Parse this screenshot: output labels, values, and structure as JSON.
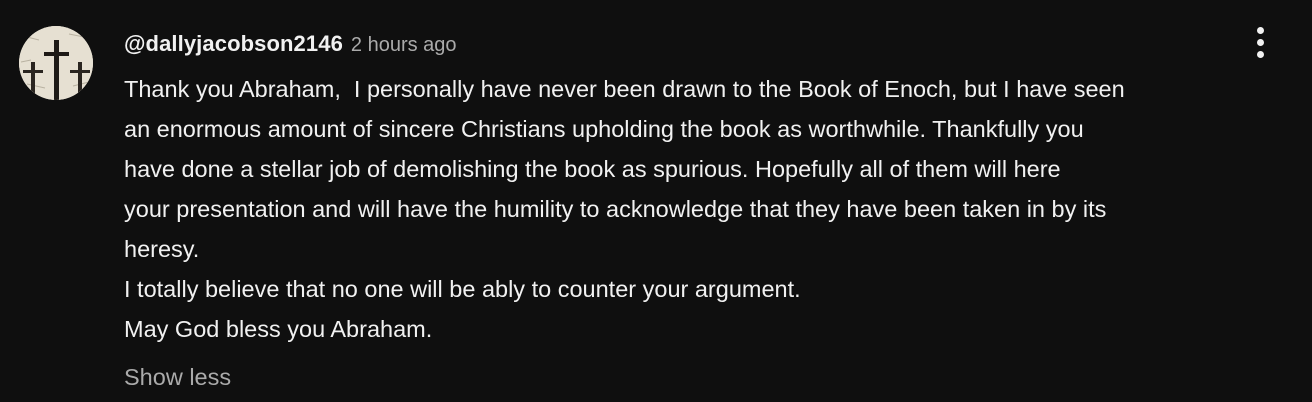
{
  "comment": {
    "avatar": {
      "icon": "crosses-avatar-icon"
    },
    "author": "@dallyjacobson2146",
    "timestamp": "2 hours ago",
    "body_lines": [
      "Thank you Abraham,  I personally have never been drawn to the Book of Enoch, but I have seen",
      "an enormous amount of sincere Christians upholding the book as worthwhile. Thankfully you",
      "have done a stellar job of demolishing the book as spurious. Hopefully all of them will here",
      "your presentation and will have the humility to acknowledge that they have been taken in by its",
      "heresy.",
      "I totally believe that no one will be ably to counter your argument.",
      "May God bless you Abraham."
    ],
    "show_less_label": "Show less",
    "menu_icon": "more-vertical-icon"
  },
  "colors": {
    "background": "#0f0f0f",
    "primary_text": "#f1f1f1",
    "secondary_text": "#aaaaaa"
  }
}
